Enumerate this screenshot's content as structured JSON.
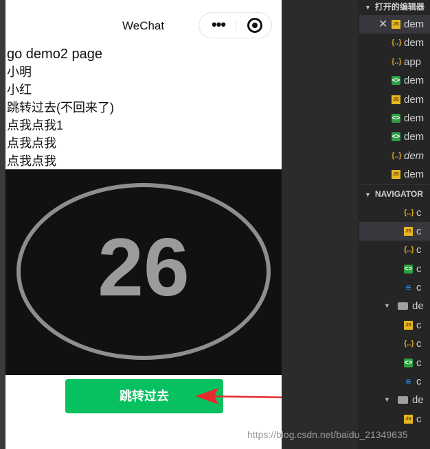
{
  "phone": {
    "title": "WeChat",
    "capsule": {
      "more_symbol": "•••"
    },
    "lines": [
      "go demo2 page",
      "小明",
      "小红",
      "跳转过去(不回来了)",
      "点我点我1",
      "点我点我",
      "点我点我"
    ],
    "image_number": "26",
    "jump_button_label": "跳转过去"
  },
  "editor": {
    "open_editors_header": "打开的编辑器",
    "navigator_header": "NAVIGATOR",
    "open_files": [
      {
        "name": "dem",
        "type": "js",
        "selected": true,
        "closable": true
      },
      {
        "name": "dem",
        "type": "json"
      },
      {
        "name": "app",
        "type": "json"
      },
      {
        "name": "dem",
        "type": "wxml"
      },
      {
        "name": "dem",
        "type": "js"
      },
      {
        "name": "dem",
        "type": "wxml"
      },
      {
        "name": "dem",
        "type": "wxml"
      },
      {
        "name": "dem",
        "type": "json",
        "italic": true
      },
      {
        "name": "dem",
        "type": "js"
      }
    ],
    "navigator_files": [
      {
        "name": "c",
        "type": "json",
        "indent": 1
      },
      {
        "name": "c",
        "type": "js",
        "indent": 1,
        "selected": true
      },
      {
        "name": "c",
        "type": "json",
        "indent": 1
      },
      {
        "name": "c",
        "type": "wxml",
        "indent": 1
      },
      {
        "name": "c",
        "type": "css",
        "indent": 1
      },
      {
        "name": "de",
        "type": "folder",
        "indent": 0,
        "expanded": true
      },
      {
        "name": "c",
        "type": "js",
        "indent": 1
      },
      {
        "name": "c",
        "type": "json",
        "indent": 1
      },
      {
        "name": "c",
        "type": "wxml",
        "indent": 1
      },
      {
        "name": "c",
        "type": "css",
        "indent": 1
      },
      {
        "name": "de",
        "type": "folder",
        "indent": 0,
        "expanded": true
      },
      {
        "name": "c",
        "type": "js",
        "indent": 1
      }
    ]
  },
  "watermark": "https://blog.csdn.net/baidu_21349635",
  "colors": {
    "button_green": "#07c160",
    "arrow_red": "#e62b2b",
    "panel_bg": "#252526"
  }
}
